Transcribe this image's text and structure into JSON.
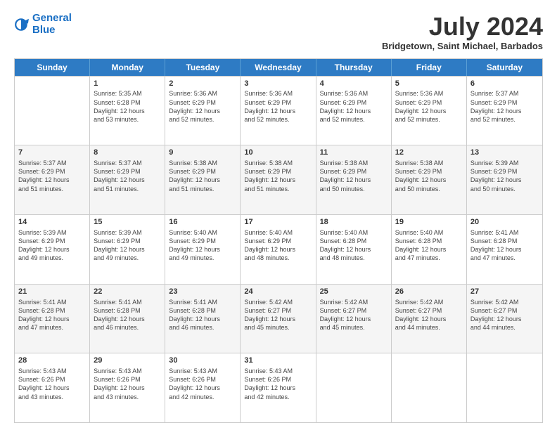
{
  "header": {
    "logo_line1": "General",
    "logo_line2": "Blue",
    "month_title": "July 2024",
    "subtitle": "Bridgetown, Saint Michael, Barbados"
  },
  "weekdays": [
    "Sunday",
    "Monday",
    "Tuesday",
    "Wednesday",
    "Thursday",
    "Friday",
    "Saturday"
  ],
  "rows": [
    [
      {
        "day": "",
        "sunrise": "",
        "sunset": "",
        "daylight": "",
        "empty": true
      },
      {
        "day": "1",
        "sunrise": "Sunrise: 5:35 AM",
        "sunset": "Sunset: 6:28 PM",
        "daylight": "Daylight: 12 hours and 53 minutes."
      },
      {
        "day": "2",
        "sunrise": "Sunrise: 5:36 AM",
        "sunset": "Sunset: 6:29 PM",
        "daylight": "Daylight: 12 hours and 52 minutes."
      },
      {
        "day": "3",
        "sunrise": "Sunrise: 5:36 AM",
        "sunset": "Sunset: 6:29 PM",
        "daylight": "Daylight: 12 hours and 52 minutes."
      },
      {
        "day": "4",
        "sunrise": "Sunrise: 5:36 AM",
        "sunset": "Sunset: 6:29 PM",
        "daylight": "Daylight: 12 hours and 52 minutes."
      },
      {
        "day": "5",
        "sunrise": "Sunrise: 5:36 AM",
        "sunset": "Sunset: 6:29 PM",
        "daylight": "Daylight: 12 hours and 52 minutes."
      },
      {
        "day": "6",
        "sunrise": "Sunrise: 5:37 AM",
        "sunset": "Sunset: 6:29 PM",
        "daylight": "Daylight: 12 hours and 52 minutes."
      }
    ],
    [
      {
        "day": "7",
        "sunrise": "Sunrise: 5:37 AM",
        "sunset": "Sunset: 6:29 PM",
        "daylight": "Daylight: 12 hours and 51 minutes."
      },
      {
        "day": "8",
        "sunrise": "Sunrise: 5:37 AM",
        "sunset": "Sunset: 6:29 PM",
        "daylight": "Daylight: 12 hours and 51 minutes."
      },
      {
        "day": "9",
        "sunrise": "Sunrise: 5:38 AM",
        "sunset": "Sunset: 6:29 PM",
        "daylight": "Daylight: 12 hours and 51 minutes."
      },
      {
        "day": "10",
        "sunrise": "Sunrise: 5:38 AM",
        "sunset": "Sunset: 6:29 PM",
        "daylight": "Daylight: 12 hours and 51 minutes."
      },
      {
        "day": "11",
        "sunrise": "Sunrise: 5:38 AM",
        "sunset": "Sunset: 6:29 PM",
        "daylight": "Daylight: 12 hours and 50 minutes."
      },
      {
        "day": "12",
        "sunrise": "Sunrise: 5:38 AM",
        "sunset": "Sunset: 6:29 PM",
        "daylight": "Daylight: 12 hours and 50 minutes."
      },
      {
        "day": "13",
        "sunrise": "Sunrise: 5:39 AM",
        "sunset": "Sunset: 6:29 PM",
        "daylight": "Daylight: 12 hours and 50 minutes."
      }
    ],
    [
      {
        "day": "14",
        "sunrise": "Sunrise: 5:39 AM",
        "sunset": "Sunset: 6:29 PM",
        "daylight": "Daylight: 12 hours and 49 minutes."
      },
      {
        "day": "15",
        "sunrise": "Sunrise: 5:39 AM",
        "sunset": "Sunset: 6:29 PM",
        "daylight": "Daylight: 12 hours and 49 minutes."
      },
      {
        "day": "16",
        "sunrise": "Sunrise: 5:40 AM",
        "sunset": "Sunset: 6:29 PM",
        "daylight": "Daylight: 12 hours and 49 minutes."
      },
      {
        "day": "17",
        "sunrise": "Sunrise: 5:40 AM",
        "sunset": "Sunset: 6:29 PM",
        "daylight": "Daylight: 12 hours and 48 minutes."
      },
      {
        "day": "18",
        "sunrise": "Sunrise: 5:40 AM",
        "sunset": "Sunset: 6:28 PM",
        "daylight": "Daylight: 12 hours and 48 minutes."
      },
      {
        "day": "19",
        "sunrise": "Sunrise: 5:40 AM",
        "sunset": "Sunset: 6:28 PM",
        "daylight": "Daylight: 12 hours and 47 minutes."
      },
      {
        "day": "20",
        "sunrise": "Sunrise: 5:41 AM",
        "sunset": "Sunset: 6:28 PM",
        "daylight": "Daylight: 12 hours and 47 minutes."
      }
    ],
    [
      {
        "day": "21",
        "sunrise": "Sunrise: 5:41 AM",
        "sunset": "Sunset: 6:28 PM",
        "daylight": "Daylight: 12 hours and 47 minutes."
      },
      {
        "day": "22",
        "sunrise": "Sunrise: 5:41 AM",
        "sunset": "Sunset: 6:28 PM",
        "daylight": "Daylight: 12 hours and 46 minutes."
      },
      {
        "day": "23",
        "sunrise": "Sunrise: 5:41 AM",
        "sunset": "Sunset: 6:28 PM",
        "daylight": "Daylight: 12 hours and 46 minutes."
      },
      {
        "day": "24",
        "sunrise": "Sunrise: 5:42 AM",
        "sunset": "Sunset: 6:27 PM",
        "daylight": "Daylight: 12 hours and 45 minutes."
      },
      {
        "day": "25",
        "sunrise": "Sunrise: 5:42 AM",
        "sunset": "Sunset: 6:27 PM",
        "daylight": "Daylight: 12 hours and 45 minutes."
      },
      {
        "day": "26",
        "sunrise": "Sunrise: 5:42 AM",
        "sunset": "Sunset: 6:27 PM",
        "daylight": "Daylight: 12 hours and 44 minutes."
      },
      {
        "day": "27",
        "sunrise": "Sunrise: 5:42 AM",
        "sunset": "Sunset: 6:27 PM",
        "daylight": "Daylight: 12 hours and 44 minutes."
      }
    ],
    [
      {
        "day": "28",
        "sunrise": "Sunrise: 5:43 AM",
        "sunset": "Sunset: 6:26 PM",
        "daylight": "Daylight: 12 hours and 43 minutes."
      },
      {
        "day": "29",
        "sunrise": "Sunrise: 5:43 AM",
        "sunset": "Sunset: 6:26 PM",
        "daylight": "Daylight: 12 hours and 43 minutes."
      },
      {
        "day": "30",
        "sunrise": "Sunrise: 5:43 AM",
        "sunset": "Sunset: 6:26 PM",
        "daylight": "Daylight: 12 hours and 42 minutes."
      },
      {
        "day": "31",
        "sunrise": "Sunrise: 5:43 AM",
        "sunset": "Sunset: 6:26 PM",
        "daylight": "Daylight: 12 hours and 42 minutes."
      },
      {
        "day": "",
        "sunrise": "",
        "sunset": "",
        "daylight": "",
        "empty": true
      },
      {
        "day": "",
        "sunrise": "",
        "sunset": "",
        "daylight": "",
        "empty": true
      },
      {
        "day": "",
        "sunrise": "",
        "sunset": "",
        "daylight": "",
        "empty": true
      }
    ]
  ]
}
